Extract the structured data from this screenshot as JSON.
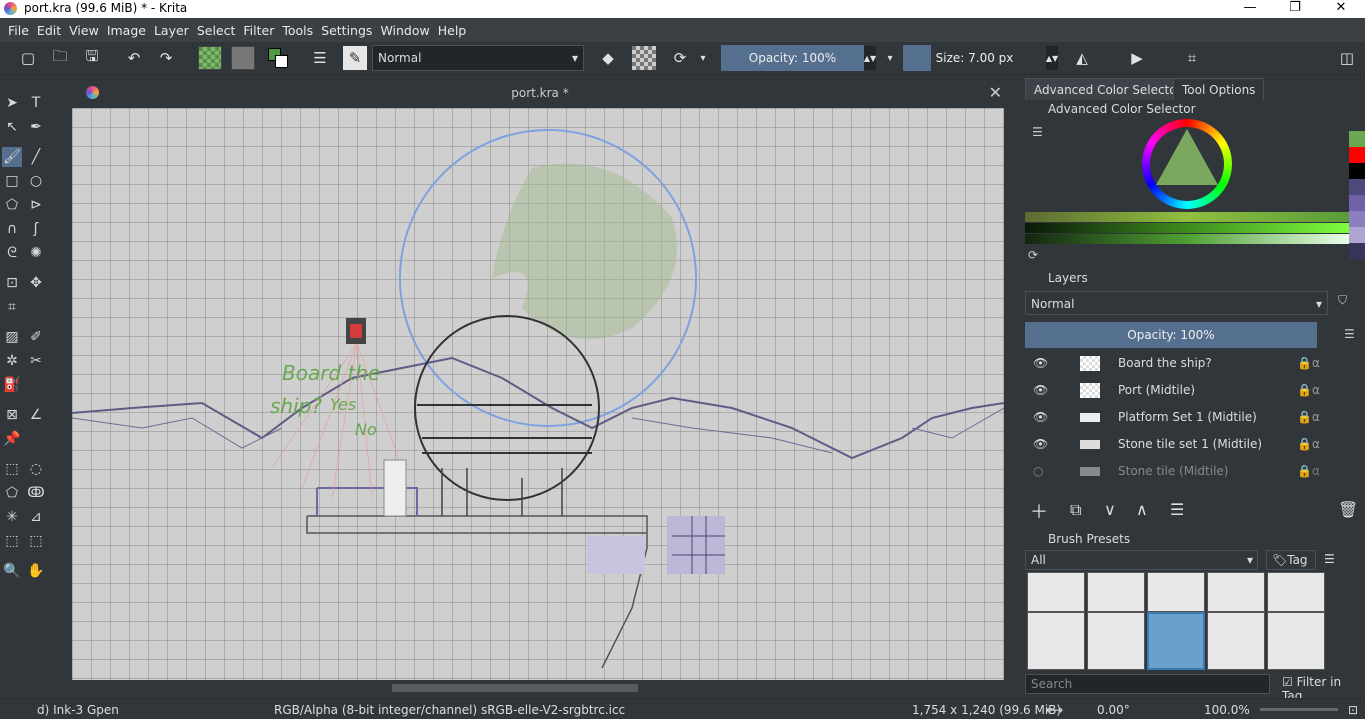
{
  "window": {
    "title": "port.kra (99.6 MiB)  * - Krita",
    "minimize": "—",
    "maximize": "❐",
    "close": "✕"
  },
  "menu": [
    "File",
    "Edit",
    "View",
    "Image",
    "Layer",
    "Select",
    "Filter",
    "Tools",
    "Settings",
    "Window",
    "Help"
  ],
  "toolbar": {
    "blend_mode": "Normal",
    "opacity": "Opacity: 100%",
    "size": "Size: 7.00 px"
  },
  "document": {
    "tab_title": "port.kra *",
    "close": "✕"
  },
  "canvas_text": {
    "line1": "Board the",
    "line2": "ship?",
    "yes": "Yes",
    "no": "No"
  },
  "color_selector": {
    "tab1": "Advanced Color Selector",
    "tab2": "Tool Options",
    "title": "Advanced Color Selector"
  },
  "swatches": [
    "#6aa84f",
    "#ff0000",
    "#000000",
    "#4b4a7a",
    "#6f60a8",
    "#8b7fbf",
    "#b0a4d4",
    "#36365a"
  ],
  "layers": {
    "title": "Layers",
    "blend_mode": "Normal",
    "opacity": "Opacity:  100%",
    "items": [
      {
        "name": "Board the ship?",
        "visible": true
      },
      {
        "name": "Port (Midtile)",
        "visible": true
      },
      {
        "name": "Platform Set 1 (Midtile)",
        "visible": true
      },
      {
        "name": "Stone tile set 1 (Midtile)",
        "visible": true
      },
      {
        "name": "Stone tile (Midtile)",
        "visible": false
      }
    ]
  },
  "brush_presets": {
    "title": "Brush Presets",
    "filter": "All",
    "tag": "Tag",
    "search_placeholder": "Search",
    "filter_in_tag": "Filter in Tag"
  },
  "status": {
    "brush": "d) Ink-3 Gpen",
    "color_model": "RGB/Alpha (8-bit integer/channel)  sRGB-elle-V2-srgbtrc.icc",
    "image_size": "1,754 x 1,240 (99.6 MiB)",
    "rotation": "0.00°",
    "zoom": "100.0%"
  }
}
